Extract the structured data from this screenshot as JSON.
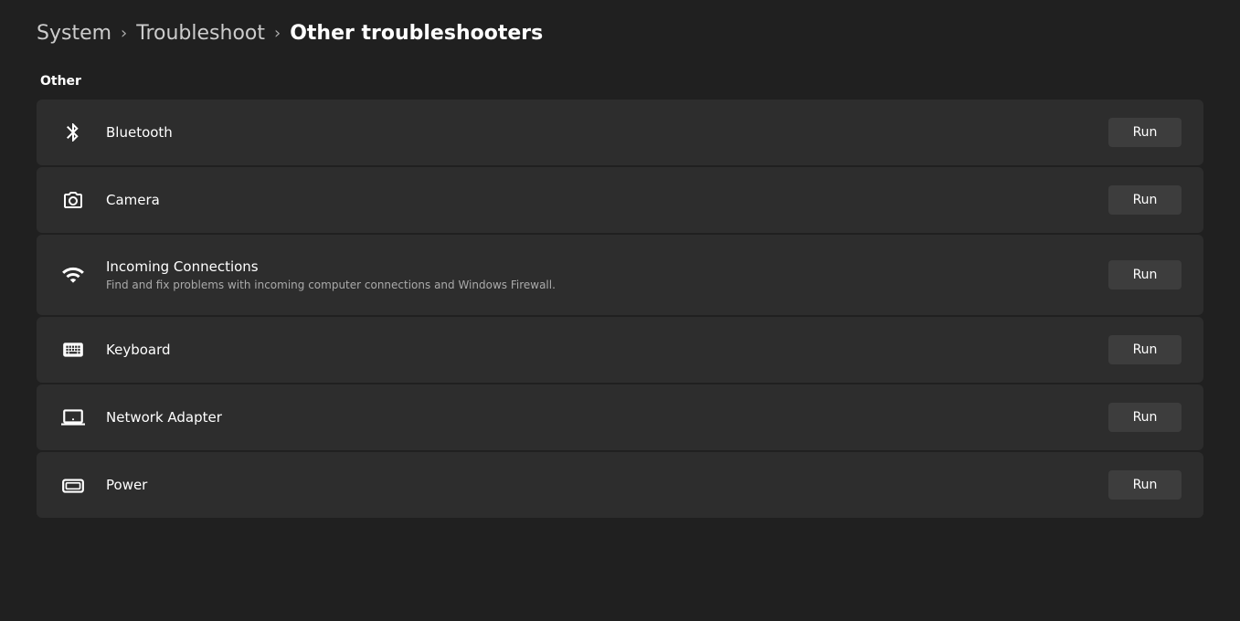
{
  "breadcrumb": {
    "items": [
      {
        "label": "System",
        "active": false
      },
      {
        "label": "Troubleshoot",
        "active": false
      },
      {
        "label": "Other troubleshooters",
        "active": true
      }
    ],
    "separators": [
      ">",
      ">"
    ]
  },
  "section": {
    "label": "Other"
  },
  "troubleshooters": [
    {
      "id": "bluetooth",
      "title": "Bluetooth",
      "subtitle": "",
      "icon": "bluetooth",
      "button_label": "Run"
    },
    {
      "id": "camera",
      "title": "Camera",
      "subtitle": "",
      "icon": "camera",
      "button_label": "Run"
    },
    {
      "id": "incoming-connections",
      "title": "Incoming Connections",
      "subtitle": "Find and fix problems with incoming computer connections and Windows Firewall.",
      "icon": "wifi",
      "button_label": "Run"
    },
    {
      "id": "keyboard",
      "title": "Keyboard",
      "subtitle": "",
      "icon": "keyboard",
      "button_label": "Run"
    },
    {
      "id": "network-adapter",
      "title": "Network Adapter",
      "subtitle": "",
      "icon": "network",
      "button_label": "Run"
    },
    {
      "id": "power",
      "title": "Power",
      "subtitle": "",
      "icon": "power",
      "button_label": "Run"
    }
  ]
}
